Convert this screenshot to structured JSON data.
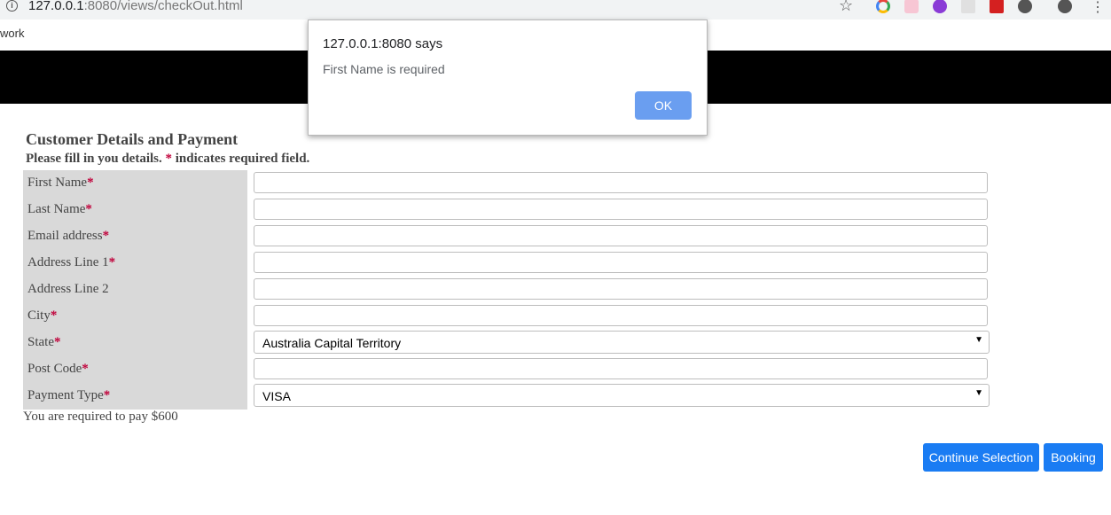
{
  "browser": {
    "url_host": "127.0.0.1",
    "url_rest": ":8080/views/checkOut.html",
    "bookmark_text": "work"
  },
  "form": {
    "title": "Customer Details and Payment",
    "subtitle_a": "Please fill in you details. ",
    "required_mark": "*",
    "subtitle_b": " indicates required field.",
    "fields": [
      {
        "label": "First Name",
        "required": "*",
        "value": ""
      },
      {
        "label": "Last Name",
        "required": "*",
        "value": ""
      },
      {
        "label": "Email address",
        "required": "*",
        "value": ""
      },
      {
        "label": "Address Line 1",
        "required": "*",
        "value": ""
      },
      {
        "label": "Address Line 2",
        "required": "",
        "value": ""
      },
      {
        "label": "City",
        "required": "*",
        "value": ""
      },
      {
        "label": "State",
        "required": "*",
        "value": "Australia Capital Territory"
      },
      {
        "label": "Post Code",
        "required": "*",
        "value": ""
      },
      {
        "label": "Payment Type",
        "required": "*",
        "value": "VISA"
      }
    ],
    "pay_note": "You are required to pay $600"
  },
  "buttons": {
    "continue": "Continue Selection",
    "booking": "Booking"
  },
  "dialog": {
    "host": "127.0.0.1:8080 says",
    "message": "First Name is required",
    "ok": "OK"
  },
  "icons": {
    "info": "info-icon",
    "star": "bookmark-star-icon",
    "dropdown": "chevron-down-icon"
  }
}
